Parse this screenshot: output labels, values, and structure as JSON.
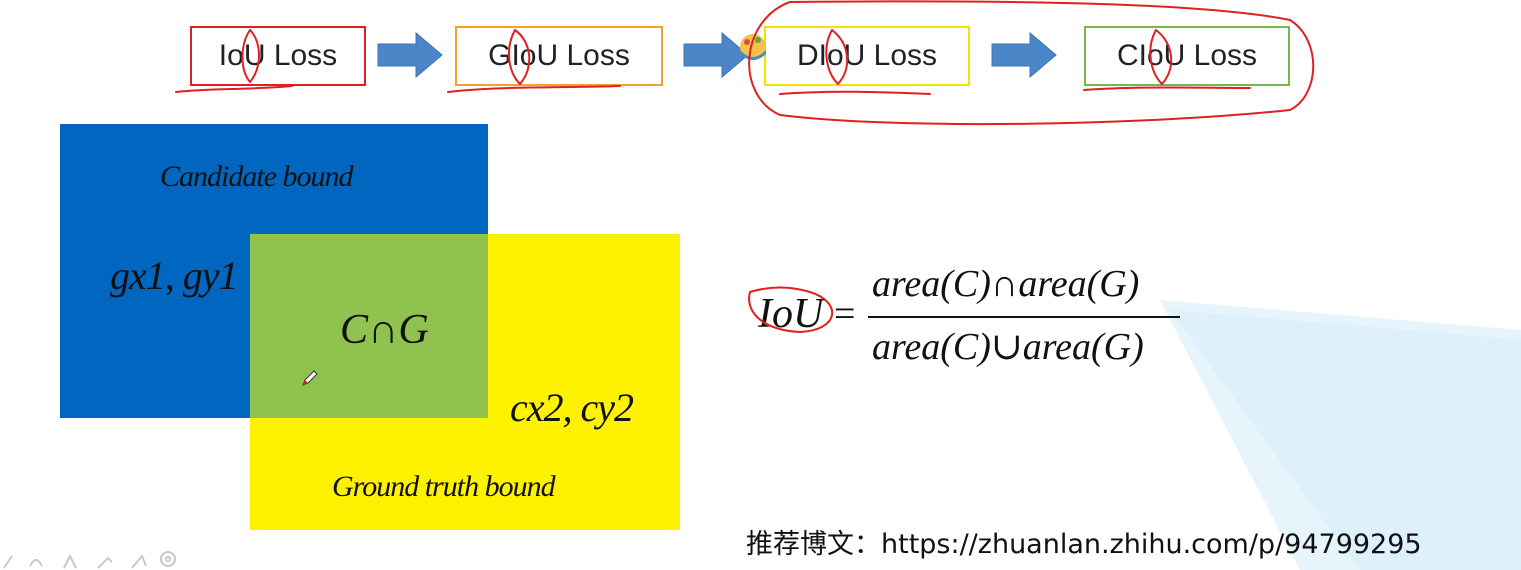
{
  "loss_chain": [
    {
      "label": "IoU Loss"
    },
    {
      "label": "GIoU Loss"
    },
    {
      "label": "DIoU Loss"
    },
    {
      "label": "CIoU Loss"
    }
  ],
  "diagram": {
    "candidate_label": "Candidate bound",
    "candidate_corner": "gx1, gy1",
    "intersection_label": "C∩G",
    "gt_corner": "cx2, cy2",
    "gt_label": "Ground truth bound"
  },
  "formula": {
    "lhs": "IoU",
    "equals": "=",
    "numerator": "area(C)∩area(G)",
    "denominator": "area(C)∪area(G)"
  },
  "footer": {
    "recommend": "推荐博文：https://zhuanlan.zhihu.com/p/94799295"
  },
  "colors": {
    "candidate": "#0066c0",
    "ground_truth": "#fff200",
    "overlap": "#8fc24e",
    "arrow": "#4a86c8",
    "annotation": "#e02020"
  }
}
